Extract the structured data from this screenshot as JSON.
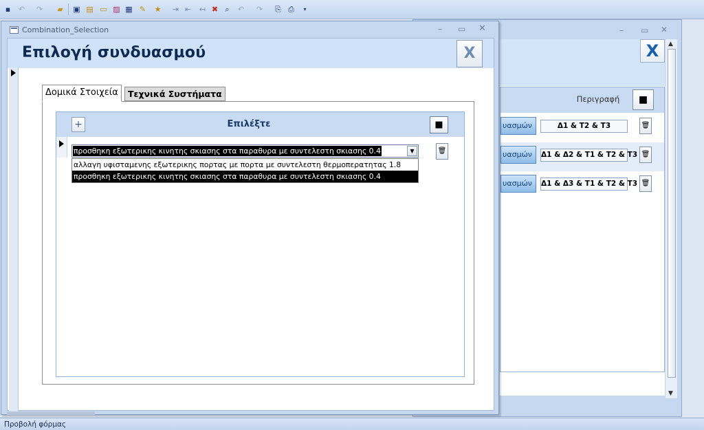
{
  "toolbar": {
    "icons": [
      "save-icon",
      "undo-icon",
      "redo-icon",
      "folder-icon",
      "view-icon",
      "form-icon",
      "textbox-icon",
      "image-icon",
      "table-icon",
      "wizard-icon",
      "folder-star-icon",
      "indent-icon",
      "outdent-icon",
      "arrange-icon",
      "delete-icon",
      "preview-icon",
      "undo-icon",
      "redo-icon",
      "export-icon",
      "print-icon",
      "customize-icon"
    ]
  },
  "dialog": {
    "window_title": "Combination_Selection",
    "header_title": "Επιλογή συνδυασμού",
    "close_label": "X",
    "tabs": [
      {
        "label": "Δομικά Στοιχεία",
        "selected": true
      },
      {
        "label": "Τεχνικά Συστήματα",
        "selected": false
      }
    ],
    "subform": {
      "add_label": "+",
      "header_label": "Επιλέξτε",
      "combo_value": "προσθηκη εξωτερικης κινητης σκιασης στα παραθυρα με συντελεστη σκιασης 0.4",
      "options": [
        "αλλαγη υφισταμενης εξωτερικης πορτας με πορτα με συντελεστη θερμοπερατητας 1.8",
        "προσθηκη εξωτερικης κινητης σκιασης στα παραθυρα με συντελεστη σκιασης 0.4"
      ]
    }
  },
  "background_window": {
    "close_label": "X",
    "column_header": "Περιγραφή",
    "rows": [
      {
        "button": "υασμών",
        "description": "Δ1 & Τ2 & Τ3"
      },
      {
        "button": "υασμών",
        "description": "Δ1 & Δ2 & Τ1 & Τ2 & Τ3"
      },
      {
        "button": "υασμών",
        "description": "Δ1 & Δ3 & Τ1 & Τ2 & Τ3"
      }
    ]
  },
  "status_bar": {
    "text": "Προβολή φόρμας"
  },
  "colors": {
    "accent": "#c6d8ef",
    "header_band": "#cfe2f7",
    "selection": "#000000"
  }
}
